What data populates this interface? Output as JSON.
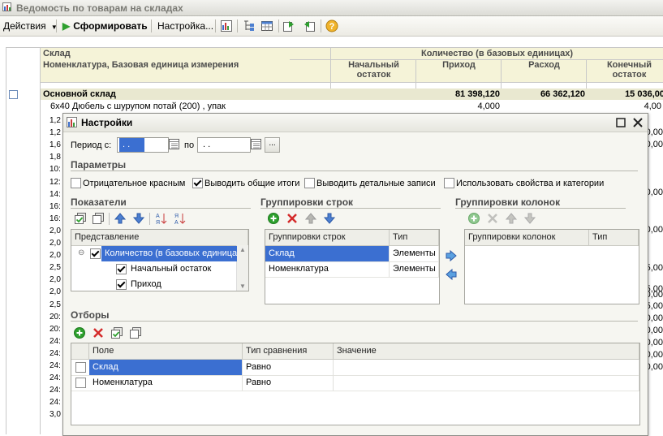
{
  "window": {
    "title": "Ведомость по товарам на складах"
  },
  "toolbar": {
    "actions_label": "Действия",
    "generate_label": "Сформировать",
    "settings_label": "Настройка..."
  },
  "report": {
    "header": {
      "warehouse": "Склад",
      "item_unit": "Номенклатура, Базовая единица измерения",
      "quantity_group": "Количество (в базовых единицах)",
      "col_start_1": "Начальный",
      "col_start_2": "остаток",
      "col_in": "Приход",
      "col_out": "Расход",
      "col_end_1": "Конечный",
      "col_end_2": "остаток"
    },
    "group_row": {
      "name": "Основной склад",
      "in": "81 398,120",
      "out": "66 362,120",
      "end": "15 036,00"
    },
    "first_item": {
      "name": "6х40 Дюбель с шурупом потай (200) , упак",
      "in": "4,000",
      "end": "4,00"
    },
    "left_numbers": [
      "1,2",
      "1,2",
      "1,6",
      "1,8",
      "10:",
      "12:",
      "14:",
      "16:",
      "16:",
      "2,0",
      "2,0",
      "2,0",
      "2,5",
      "2,0",
      "2,0",
      "2,5",
      "20:",
      "20:",
      "24:",
      "24:",
      "24:",
      "24:",
      "24:",
      "24:",
      "3,0"
    ],
    "right_numbers": [
      "0,00",
      "0,00",
      "0,00",
      "0,00",
      "5,00",
      "5,00",
      "0,00",
      "5,00",
      "0,00",
      "0,00",
      "0,00",
      "0,00",
      "0,00"
    ]
  },
  "dialog": {
    "title": "Настройки",
    "period_from_label": "Период с:",
    "period_from_value": ". .",
    "period_to_label": "по",
    "period_to_value": ". .",
    "period_button": "...",
    "params_title": "Параметры",
    "params": [
      {
        "label": "Отрицательное красным",
        "checked": false
      },
      {
        "label": "Выводить общие итоги",
        "checked": true
      },
      {
        "label": "Выводить детальные записи",
        "checked": false
      },
      {
        "label": "Использовать свойства и категории",
        "checked": false
      }
    ],
    "indicators": {
      "title": "Показатели",
      "column": "Представление",
      "rows": [
        {
          "label": "Количество (в базовых единица",
          "checked": true,
          "selected": true
        },
        {
          "label": "Начальный остаток",
          "checked": true,
          "selected": false
        },
        {
          "label": "Приход",
          "checked": true,
          "selected": false
        }
      ]
    },
    "row_groupings": {
      "title": "Группировки строк",
      "columns": [
        "Группировки строк",
        "Тип"
      ],
      "rows": [
        {
          "name": "Склад",
          "type": "Элементы",
          "selected": true
        },
        {
          "name": "Номенклатура",
          "type": "Элементы",
          "selected": false
        }
      ]
    },
    "column_groupings": {
      "title": "Группировки колонок",
      "columns": [
        "Группировки колонок",
        "Тип"
      ]
    },
    "filters": {
      "title": "Отборы",
      "columns": [
        "Поле",
        "Тип сравнения",
        "Значение"
      ],
      "rows": [
        {
          "field": "Склад",
          "comparison": "Равно",
          "value": "",
          "selected": true
        },
        {
          "field": "Номенклатура",
          "comparison": "Равно",
          "value": "",
          "selected": false
        }
      ]
    }
  },
  "colors": {
    "selection": "#3b6fd1",
    "header_bg": "#f5f3d8",
    "group_bg": "#e9e8d0",
    "green": "#2ea02e",
    "red": "#d42a2a",
    "blue": "#4c7fd0"
  }
}
